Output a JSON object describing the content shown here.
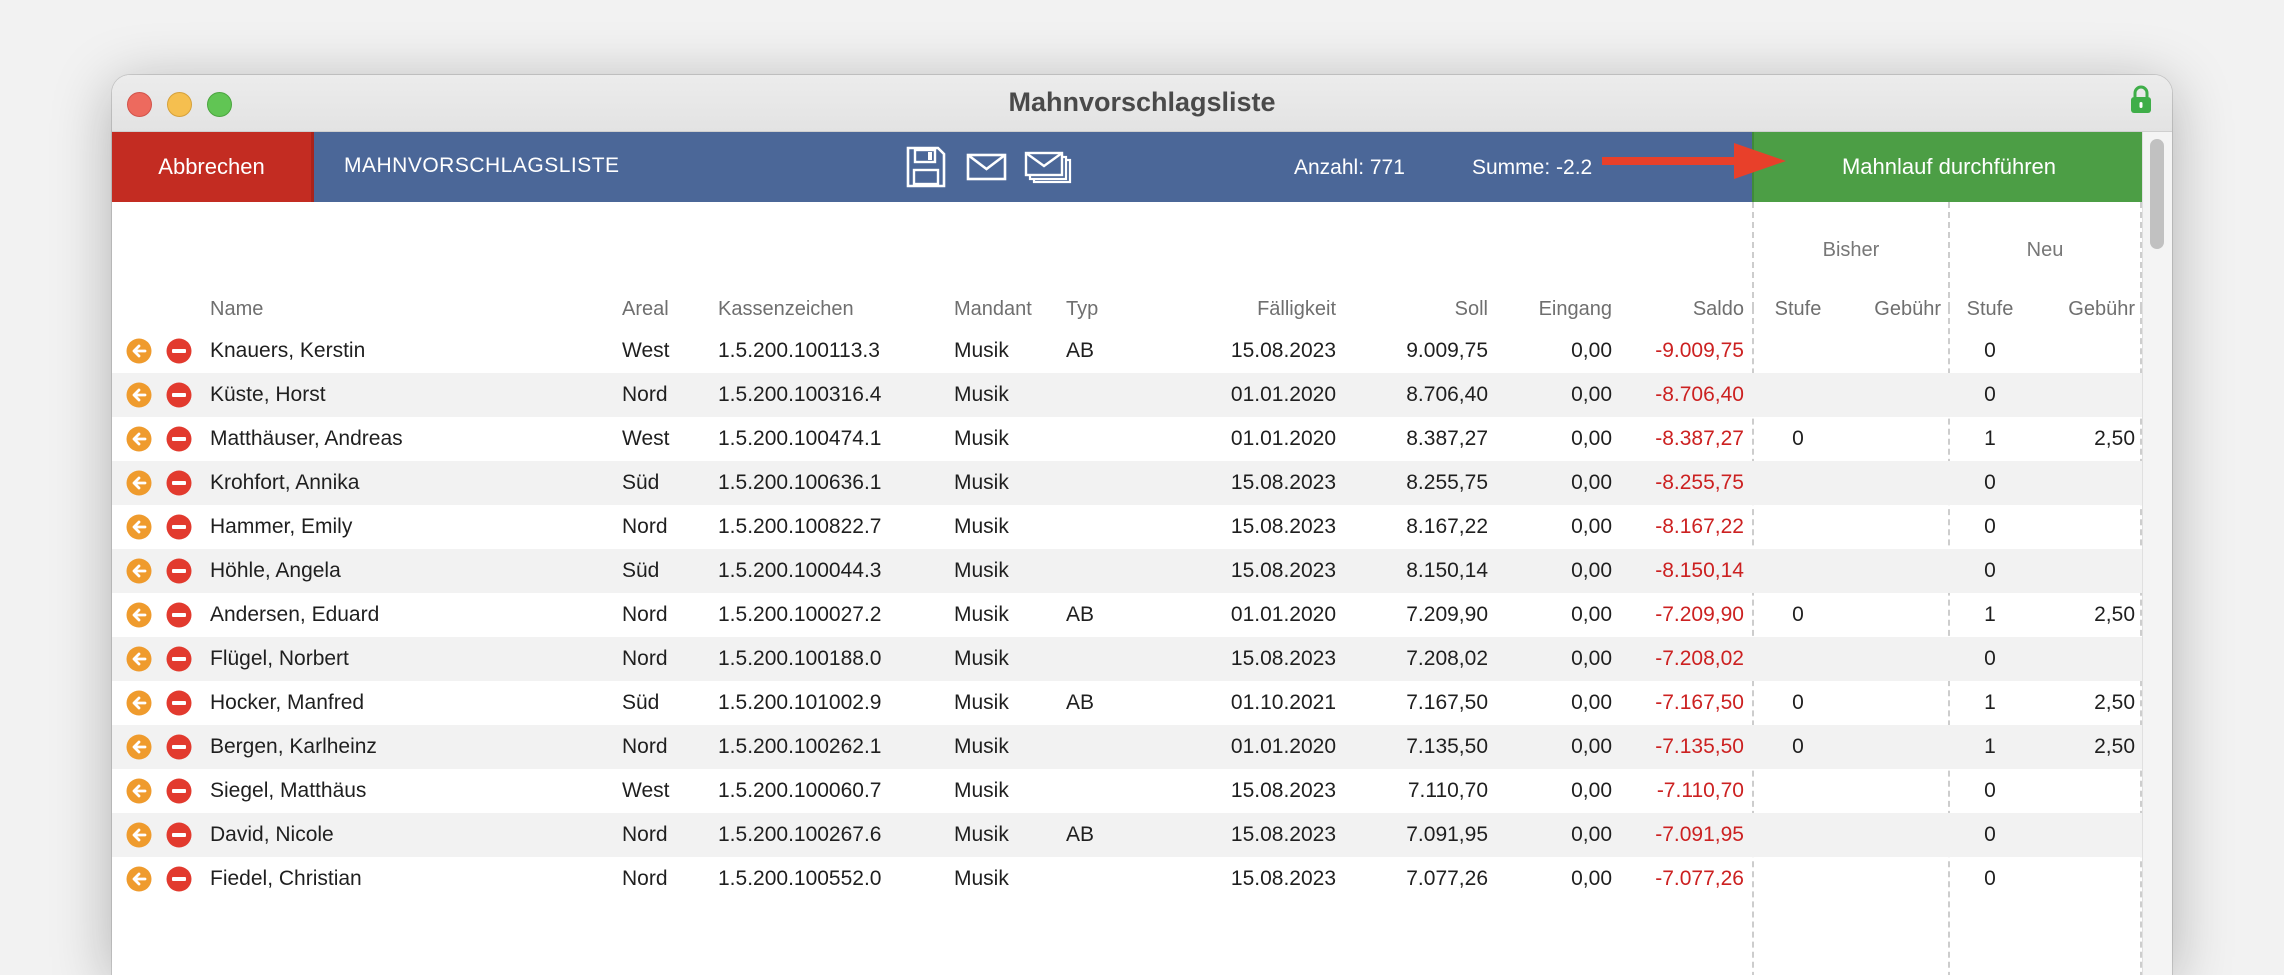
{
  "window": {
    "title": "Mahnvorschlagsliste"
  },
  "toolbar": {
    "cancel_label": "Abbrechen",
    "title": "MAHNVORSCHLAGSLISTE",
    "count_label": "Anzahl: 771",
    "sum_label": "Summe: -2.2",
    "run_label": "Mahnlauf durchführen",
    "icons": [
      "save-icon",
      "mail-icon",
      "mail-batch-icon"
    ]
  },
  "colors": {
    "toolbar": "#4b6798",
    "cancel": "#c32c22",
    "run": "#4c9e45",
    "negative": "#cc2121",
    "arrow": "#e8402a"
  },
  "table": {
    "groups": {
      "bisher": "Bisher",
      "neu": "Neu"
    },
    "columns": {
      "name": "Name",
      "areal": "Areal",
      "kassenzeichen": "Kassenzeichen",
      "mandant": "Mandant",
      "typ": "Typ",
      "faelligkeit": "Fälligkeit",
      "soll": "Soll",
      "eingang": "Eingang",
      "saldo": "Saldo",
      "bisher_stufe": "Stufe",
      "bisher_gebuehr": "Gebühr",
      "neu_stufe": "Stufe",
      "neu_gebuehr": "Gebühr"
    },
    "rows": [
      {
        "name": "Knauers, Kerstin",
        "areal": "West",
        "kassenzeichen": "1.5.200.100113.3",
        "mandant": "Musik",
        "typ": "AB",
        "faelligkeit": "15.08.2023",
        "soll": "9.009,75",
        "eingang": "0,00",
        "saldo": "-9.009,75",
        "bisher_stufe": "",
        "bisher_gebuehr": "",
        "neu_stufe": "0",
        "neu_gebuehr": ""
      },
      {
        "name": "Küste, Horst",
        "areal": "Nord",
        "kassenzeichen": "1.5.200.100316.4",
        "mandant": "Musik",
        "typ": "",
        "faelligkeit": "01.01.2020",
        "soll": "8.706,40",
        "eingang": "0,00",
        "saldo": "-8.706,40",
        "bisher_stufe": "",
        "bisher_gebuehr": "",
        "neu_stufe": "0",
        "neu_gebuehr": ""
      },
      {
        "name": "Matthäuser, Andreas",
        "areal": "West",
        "kassenzeichen": "1.5.200.100474.1",
        "mandant": "Musik",
        "typ": "",
        "faelligkeit": "01.01.2020",
        "soll": "8.387,27",
        "eingang": "0,00",
        "saldo": "-8.387,27",
        "bisher_stufe": "0",
        "bisher_gebuehr": "",
        "neu_stufe": "1",
        "neu_gebuehr": "2,50"
      },
      {
        "name": "Krohfort, Annika",
        "areal": "Süd",
        "kassenzeichen": "1.5.200.100636.1",
        "mandant": "Musik",
        "typ": "",
        "faelligkeit": "15.08.2023",
        "soll": "8.255,75",
        "eingang": "0,00",
        "saldo": "-8.255,75",
        "bisher_stufe": "",
        "bisher_gebuehr": "",
        "neu_stufe": "0",
        "neu_gebuehr": ""
      },
      {
        "name": "Hammer, Emily",
        "areal": "Nord",
        "kassenzeichen": "1.5.200.100822.7",
        "mandant": "Musik",
        "typ": "",
        "faelligkeit": "15.08.2023",
        "soll": "8.167,22",
        "eingang": "0,00",
        "saldo": "-8.167,22",
        "bisher_stufe": "",
        "bisher_gebuehr": "",
        "neu_stufe": "0",
        "neu_gebuehr": ""
      },
      {
        "name": "Höhle, Angela",
        "areal": "Süd",
        "kassenzeichen": "1.5.200.100044.3",
        "mandant": "Musik",
        "typ": "",
        "faelligkeit": "15.08.2023",
        "soll": "8.150,14",
        "eingang": "0,00",
        "saldo": "-8.150,14",
        "bisher_stufe": "",
        "bisher_gebuehr": "",
        "neu_stufe": "0",
        "neu_gebuehr": ""
      },
      {
        "name": "Andersen, Eduard",
        "areal": "Nord",
        "kassenzeichen": "1.5.200.100027.2",
        "mandant": "Musik",
        "typ": "AB",
        "faelligkeit": "01.01.2020",
        "soll": "7.209,90",
        "eingang": "0,00",
        "saldo": "-7.209,90",
        "bisher_stufe": "0",
        "bisher_gebuehr": "",
        "neu_stufe": "1",
        "neu_gebuehr": "2,50"
      },
      {
        "name": "Flügel, Norbert",
        "areal": "Nord",
        "kassenzeichen": "1.5.200.100188.0",
        "mandant": "Musik",
        "typ": "",
        "faelligkeit": "15.08.2023",
        "soll": "7.208,02",
        "eingang": "0,00",
        "saldo": "-7.208,02",
        "bisher_stufe": "",
        "bisher_gebuehr": "",
        "neu_stufe": "0",
        "neu_gebuehr": ""
      },
      {
        "name": "Hocker, Manfred",
        "areal": "Süd",
        "kassenzeichen": "1.5.200.101002.9",
        "mandant": "Musik",
        "typ": "AB",
        "faelligkeit": "01.10.2021",
        "soll": "7.167,50",
        "eingang": "0,00",
        "saldo": "-7.167,50",
        "bisher_stufe": "0",
        "bisher_gebuehr": "",
        "neu_stufe": "1",
        "neu_gebuehr": "2,50"
      },
      {
        "name": "Bergen, Karlheinz",
        "areal": "Nord",
        "kassenzeichen": "1.5.200.100262.1",
        "mandant": "Musik",
        "typ": "",
        "faelligkeit": "01.01.2020",
        "soll": "7.135,50",
        "eingang": "0,00",
        "saldo": "-7.135,50",
        "bisher_stufe": "0",
        "bisher_gebuehr": "",
        "neu_stufe": "1",
        "neu_gebuehr": "2,50"
      },
      {
        "name": "Siegel, Matthäus",
        "areal": "West",
        "kassenzeichen": "1.5.200.100060.7",
        "mandant": "Musik",
        "typ": "",
        "faelligkeit": "15.08.2023",
        "soll": "7.110,70",
        "eingang": "0,00",
        "saldo": "-7.110,70",
        "bisher_stufe": "",
        "bisher_gebuehr": "",
        "neu_stufe": "0",
        "neu_gebuehr": ""
      },
      {
        "name": "David, Nicole",
        "areal": "Nord",
        "kassenzeichen": "1.5.200.100267.6",
        "mandant": "Musik",
        "typ": "AB",
        "faelligkeit": "15.08.2023",
        "soll": "7.091,95",
        "eingang": "0,00",
        "saldo": "-7.091,95",
        "bisher_stufe": "",
        "bisher_gebuehr": "",
        "neu_stufe": "0",
        "neu_gebuehr": ""
      },
      {
        "name": "Fiedel, Christian",
        "areal": "Nord",
        "kassenzeichen": "1.5.200.100552.0",
        "mandant": "Musik",
        "typ": "",
        "faelligkeit": "15.08.2023",
        "soll": "7.077,26",
        "eingang": "0,00",
        "saldo": "-7.077,26",
        "bisher_stufe": "",
        "bisher_gebuehr": "",
        "neu_stufe": "0",
        "neu_gebuehr": ""
      }
    ]
  }
}
